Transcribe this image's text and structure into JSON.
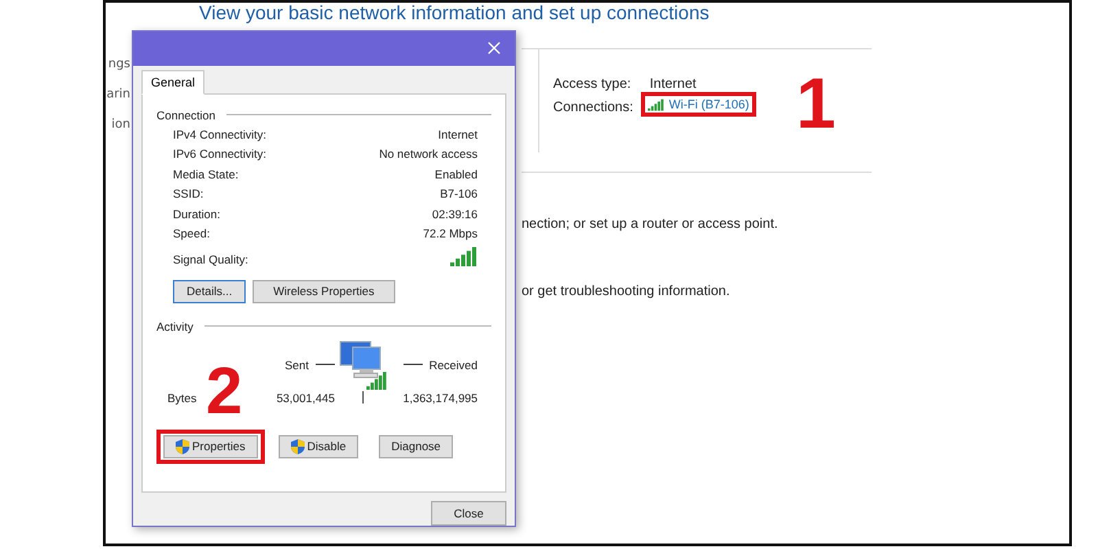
{
  "background_window": {
    "heading": "View your basic network information and set up connections",
    "sidebar_fragments": [
      "ngs",
      "arin",
      "ion"
    ],
    "access_type_label": "Access type:",
    "access_type": "Internet",
    "connections_label": "Connections:",
    "connection_link": {
      "label": "Wi-Fi (B7-106)",
      "highlighted": true
    },
    "task_texts": [
      "nection; or set up a router or access point.",
      "or get troubleshooting information."
    ]
  },
  "dialog": {
    "tabs": [
      {
        "label": "General",
        "selected": true
      }
    ],
    "connection_group": "Connection",
    "rows": [
      {
        "kind": "text",
        "label": "IPv4 Connectivity:",
        "value": "Internet"
      },
      {
        "kind": "text",
        "label": "IPv6 Connectivity:",
        "value": "No network access"
      },
      {
        "kind": "text",
        "label": "Media State:",
        "value": "Enabled"
      },
      {
        "kind": "text",
        "label": "SSID:",
        "value": "B7-106"
      },
      {
        "kind": "text",
        "label": "Duration:",
        "value": "02:39:16"
      },
      {
        "kind": "text",
        "label": "Speed:",
        "value": "72.2 Mbps"
      },
      {
        "kind": "signal",
        "label": "Signal Quality:"
      }
    ],
    "connection_buttons": [
      {
        "label": "Details...",
        "default": true
      },
      {
        "label": "Wireless Properties",
        "default": false
      }
    ],
    "activity_group": "Activity",
    "sent_label": "Sent",
    "received_label": "Received",
    "bytes_label": "Bytes",
    "bytes_sent": "53,001,445",
    "bytes_received": "1,363,174,995",
    "activity_buttons": [
      {
        "label": "Properties",
        "shield": true,
        "highlighted": true
      },
      {
        "label": "Disable",
        "shield": true,
        "highlighted": false
      },
      {
        "label": "Diagnose",
        "shield": false,
        "highlighted": false
      }
    ],
    "close_button": "Close"
  },
  "annotations": [
    {
      "label": "1"
    },
    {
      "label": "2"
    }
  ]
}
